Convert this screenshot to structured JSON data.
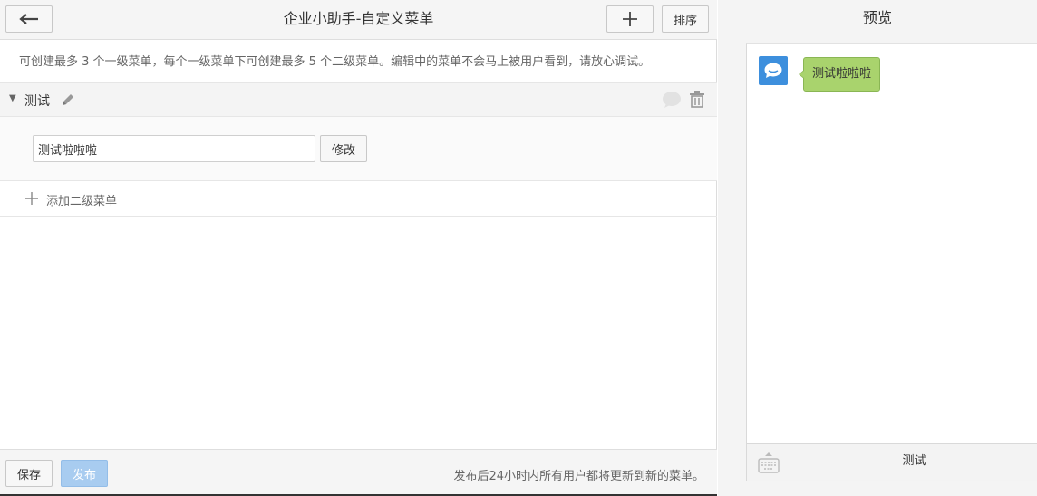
{
  "header": {
    "title": "企业小助手-自定义菜单",
    "sort_label": "排序"
  },
  "notice": "可创建最多 3 个一级菜单，每个一级菜单下可创建最多 5 个二级菜单。编辑中的菜单不会马上被用户看到，请放心调试。",
  "menu": {
    "name": "测试",
    "edit": {
      "input_value": "测试啦啦啦",
      "modify_label": "修改"
    },
    "add_sub_label": "添加二级菜单"
  },
  "footer": {
    "save_label": "保存",
    "publish_label": "发布",
    "tip": "发布后24小时内所有用户都将更新到新的菜单。"
  },
  "preview": {
    "title": "预览",
    "message": "测试啦啦啦",
    "menu_tab": "测试"
  },
  "colors": {
    "accent_blue": "#3d8fdd",
    "message_green": "#a9d36d",
    "publish_disabled": "#a8ccf0"
  },
  "icons": [
    "arrow-left-icon",
    "plus-icon",
    "caret-down-icon",
    "pencil-icon",
    "chat-bubble-icon",
    "trash-icon",
    "keyboard-icon"
  ]
}
